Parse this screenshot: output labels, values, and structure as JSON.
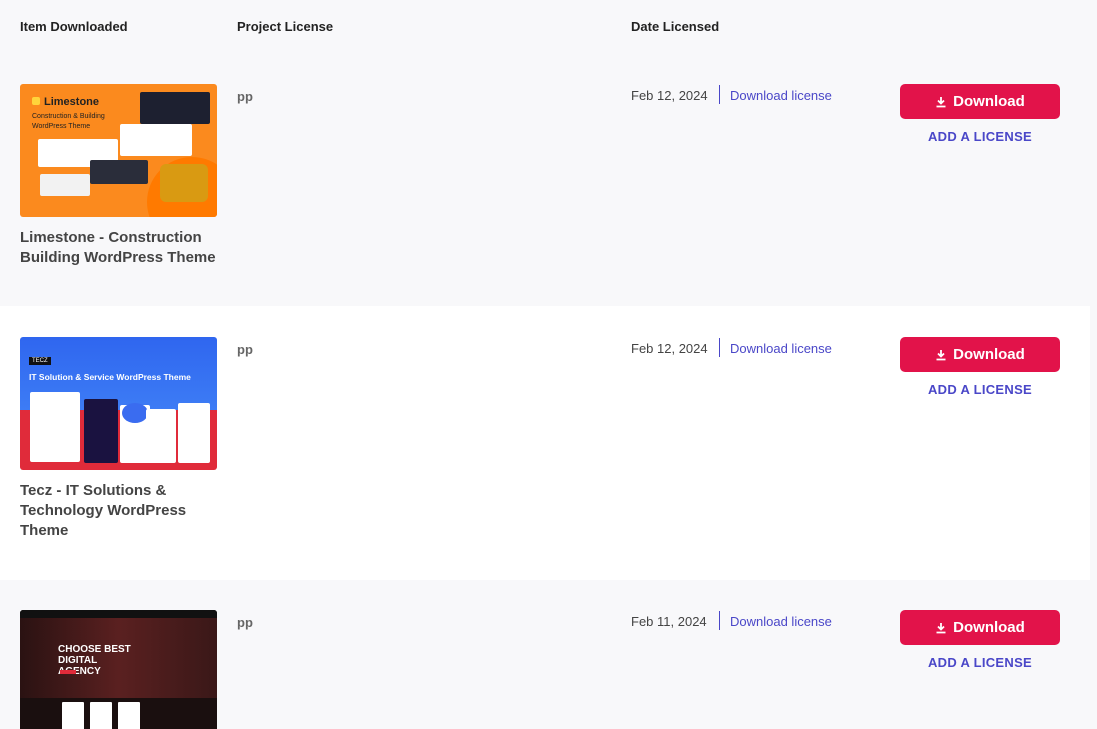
{
  "header": {
    "item_downloaded": "Item Downloaded",
    "project_license": "Project License",
    "date_licensed": "Date Licensed"
  },
  "rows": [
    {
      "title": "Limestone - Construction Building WordPress Theme",
      "thumb_brand": "Limestone",
      "thumb_subtitle": "Construction & Building WordPress Theme",
      "project": "pp",
      "date": "Feb 12, 2024",
      "download_license": "Download license",
      "download_button": "Download",
      "add_license": "ADD A LICENSE"
    },
    {
      "title": "Tecz - IT Solutions & Technology WordPress Theme",
      "thumb_badge": "TECZ",
      "thumb_title": "IT Solution & Service WordPress Theme",
      "project": "pp",
      "date": "Feb 12, 2024",
      "download_license": "Download license",
      "download_button": "Download",
      "add_license": "ADD A LICENSE"
    },
    {
      "thumb_title": "CHOOSE BEST DIGITAL AGENCY",
      "project": "pp",
      "date": "Feb 11, 2024",
      "download_license": "Download license",
      "download_button": "Download",
      "add_license": "ADD A LICENSE"
    }
  ],
  "colors": {
    "accent": "#e2134a",
    "link": "#4a47c8",
    "background": "#f8f8fa"
  },
  "icons": {
    "download": "download-arrow-icon"
  }
}
